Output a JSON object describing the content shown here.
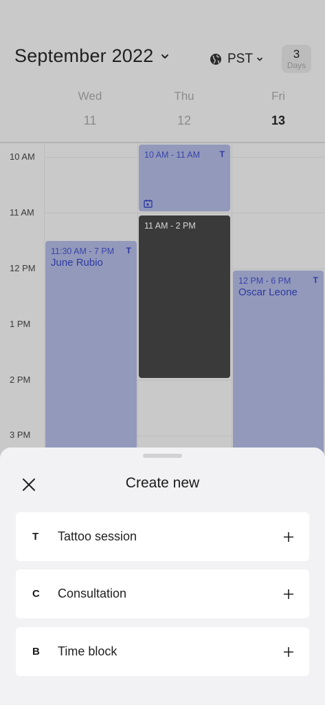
{
  "calendar": {
    "month_title": "September 2022",
    "timezone": "PST",
    "view": {
      "count": "3",
      "unit": "Days"
    },
    "days": [
      {
        "name": "Wed",
        "date": "11",
        "today": false
      },
      {
        "name": "Thu",
        "date": "12",
        "today": false
      },
      {
        "name": "Fri",
        "date": "13",
        "today": true
      }
    ],
    "hours": [
      "10 AM",
      "11 AM",
      "12 PM",
      "1 PM",
      "2 PM",
      "3 PM"
    ],
    "events": [
      {
        "time": "10 AM - 11 AM",
        "name": "",
        "tag": "T",
        "day": "Thu"
      },
      {
        "time": "11 AM - 2 PM",
        "name": "",
        "tag": "",
        "day": "Thu"
      },
      {
        "time": "11:30 AM - 7 PM",
        "name": "June Rubio",
        "tag": "T",
        "day": "Wed"
      },
      {
        "time": "12 PM - 6 PM",
        "name": "Oscar Leone",
        "tag": "T",
        "day": "Fri"
      }
    ],
    "colors": {
      "event_blue": "#9299bb",
      "event_dark": "#3a3a3a",
      "event_text": "#2f3aa0"
    }
  },
  "sheet": {
    "title": "Create new",
    "options": [
      {
        "key": "T",
        "label": "Tattoo session"
      },
      {
        "key": "C",
        "label": "Consultation"
      },
      {
        "key": "B",
        "label": "Time block"
      }
    ]
  }
}
